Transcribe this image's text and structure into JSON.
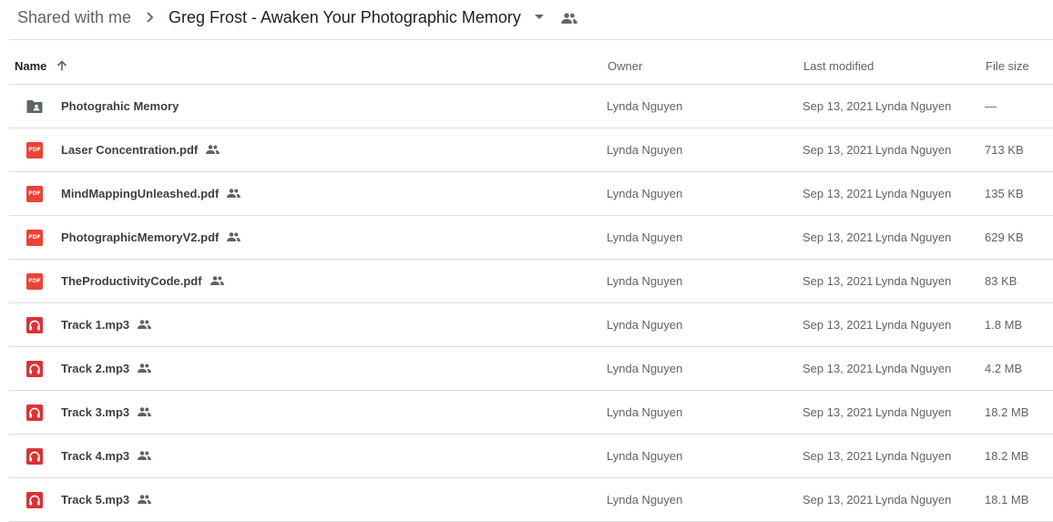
{
  "breadcrumb": {
    "root": "Shared with me",
    "current": "Greg Frost - Awaken Your Photographic Memory",
    "separator_icon": "chevron-right-icon",
    "dropdown_icon": "arrow-drop-down-icon",
    "shared_icon": "people-icon"
  },
  "header": {
    "name": "Name",
    "sort_icon": "arrow-upward-icon",
    "owner": "Owner",
    "last_modified": "Last modified",
    "file_size": "File size"
  },
  "colors": {
    "pdf_red": "#ea4335",
    "audio_red": "#db3236",
    "folder_gray": "#5f6368",
    "divider": "#dadce0"
  },
  "files": [
    {
      "name": "Photograhic Memory",
      "type": "shared-folder",
      "shared": false,
      "owner": "Lynda Nguyen",
      "modified_date": "Sep 13, 2021",
      "modified_by": "Lynda Nguyen",
      "size": "—"
    },
    {
      "name": "Laser Concentration.pdf",
      "type": "pdf",
      "shared": true,
      "owner": "Lynda Nguyen",
      "modified_date": "Sep 13, 2021",
      "modified_by": "Lynda Nguyen",
      "size": "713 KB"
    },
    {
      "name": "MindMappingUnleashed.pdf",
      "type": "pdf",
      "shared": true,
      "owner": "Lynda Nguyen",
      "modified_date": "Sep 13, 2021",
      "modified_by": "Lynda Nguyen",
      "size": "135 KB"
    },
    {
      "name": "PhotographicMemoryV2.pdf",
      "type": "pdf",
      "shared": true,
      "owner": "Lynda Nguyen",
      "modified_date": "Sep 13, 2021",
      "modified_by": "Lynda Nguyen",
      "size": "629 KB"
    },
    {
      "name": "TheProductivityCode.pdf",
      "type": "pdf",
      "shared": true,
      "owner": "Lynda Nguyen",
      "modified_date": "Sep 13, 2021",
      "modified_by": "Lynda Nguyen",
      "size": "83 KB"
    },
    {
      "name": "Track 1.mp3",
      "type": "audio",
      "shared": true,
      "owner": "Lynda Nguyen",
      "modified_date": "Sep 13, 2021",
      "modified_by": "Lynda Nguyen",
      "size": "1.8 MB"
    },
    {
      "name": "Track 2.mp3",
      "type": "audio",
      "shared": true,
      "owner": "Lynda Nguyen",
      "modified_date": "Sep 13, 2021",
      "modified_by": "Lynda Nguyen",
      "size": "4.2 MB"
    },
    {
      "name": "Track 3.mp3",
      "type": "audio",
      "shared": true,
      "owner": "Lynda Nguyen",
      "modified_date": "Sep 13, 2021",
      "modified_by": "Lynda Nguyen",
      "size": "18.2 MB"
    },
    {
      "name": "Track 4.mp3",
      "type": "audio",
      "shared": true,
      "owner": "Lynda Nguyen",
      "modified_date": "Sep 13, 2021",
      "modified_by": "Lynda Nguyen",
      "size": "18.2 MB"
    },
    {
      "name": "Track 5.mp3",
      "type": "audio",
      "shared": true,
      "owner": "Lynda Nguyen",
      "modified_date": "Sep 13, 2021",
      "modified_by": "Lynda Nguyen",
      "size": "18.1 MB"
    }
  ]
}
